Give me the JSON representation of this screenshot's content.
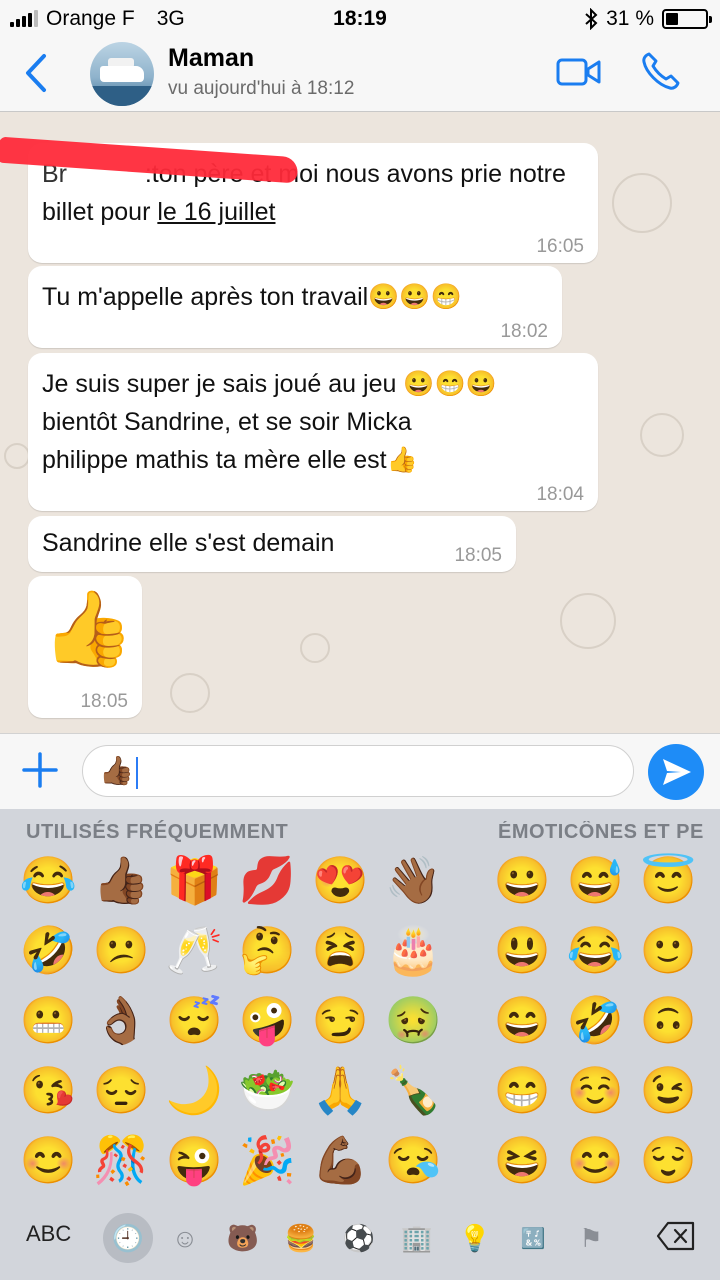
{
  "status_bar": {
    "carrier": "Orange F",
    "network": "3G",
    "time": "18:19",
    "battery_percent": "31 %",
    "battery_level": 0.31
  },
  "header": {
    "contact_name": "Maman",
    "last_seen": "vu aujourd'hui à 18:12"
  },
  "messages": [
    {
      "text_before": "Br",
      "text_main": ":ton père et moi nous avons prie notre billet pour ",
      "text_underlined": "le 16 juillet",
      "time": "16:05"
    },
    {
      "text": "Tu m'appelle après ton travail😀😀😁",
      "time": "18:02"
    },
    {
      "line1": "Je suis super je sais joué au jeu 😀😁😀",
      "line2": "bientôt Sandrine, et se soir Micka",
      "line3": "philippe  mathis  ta mère elle est👍",
      "time": "18:04"
    },
    {
      "text": "Sandrine elle s'est demain",
      "time": "18:05"
    },
    {
      "emoji": "👍",
      "time": "18:05"
    }
  ],
  "composer": {
    "value": "👍🏾"
  },
  "keyboard": {
    "section_frequent": "UTILISÉS FRÉQUEMMENT",
    "section_smileys": "ÉMOTICÔNES ET PE",
    "frequent": [
      "😂",
      "👍🏾",
      "🎁",
      "💋",
      "😍",
      "👋🏾",
      "🤣",
      "😕",
      "🥂",
      "🤔",
      "😫",
      "🎂",
      "😬",
      "👌🏾",
      "😴",
      "🤪",
      "😏",
      "🤢",
      "😘",
      "😔",
      "🌙",
      "🥗",
      "🙏",
      "🍾",
      "😊",
      "🎊",
      "😜",
      "🎉",
      "💪🏾",
      "😪"
    ],
    "smileys": [
      "😀",
      "😅",
      "😇",
      "😃",
      "😂",
      "🙂",
      "😄",
      "🤣",
      "🙃",
      "😁",
      "☺️",
      "😉",
      "😆",
      "😊",
      "😌"
    ],
    "abc_label": "ABC",
    "categories": [
      "🕘",
      "☺",
      "🐻",
      "🍔",
      "⚽",
      "🏢",
      "💡",
      "🔣",
      "⚑"
    ]
  }
}
